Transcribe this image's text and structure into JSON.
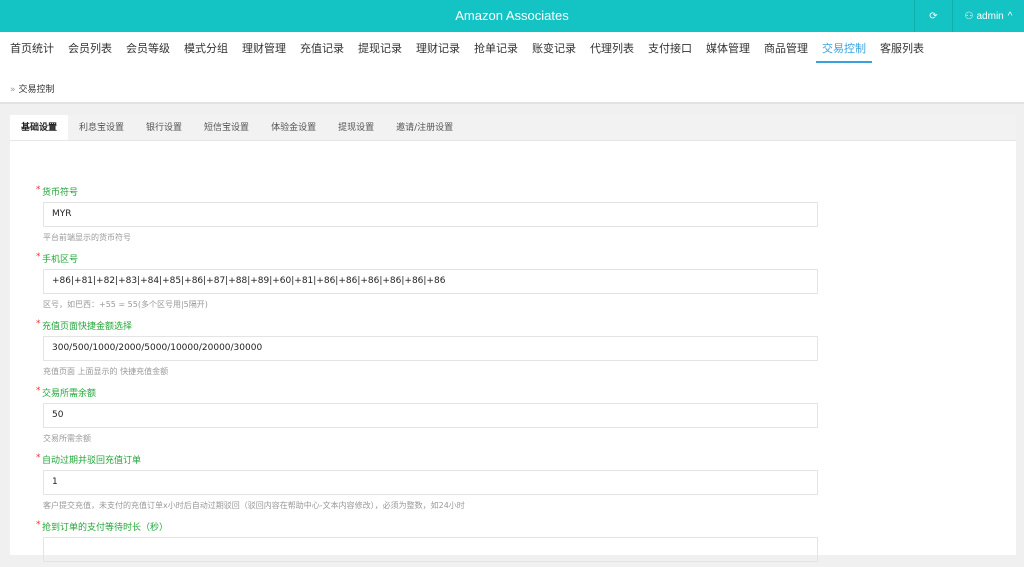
{
  "header": {
    "title": "Amazon Associates",
    "refresh_icon": "refresh-icon",
    "user": "admin"
  },
  "nav": {
    "items": [
      "首页统计",
      "会员列表",
      "会员等级",
      "模式分组",
      "理财管理",
      "充值记录",
      "提现记录",
      "理财记录",
      "抢单记录",
      "账变记录",
      "代理列表",
      "支付接口",
      "媒体管理",
      "商品管理",
      "交易控制",
      "客服列表"
    ],
    "active": 14
  },
  "breadcrumb": {
    "sep": "»",
    "current": "交易控制"
  },
  "tabs": [
    "基础设置",
    "利息宝设置",
    "银行设置",
    "短信宝设置",
    "体验金设置",
    "提现设置",
    "邀请/注册设置"
  ],
  "fields": [
    {
      "label": "货币符号",
      "value": "MYR",
      "help": "平台前端显示的货币符号"
    },
    {
      "label": "手机区号",
      "value": "+86|+81|+82|+83|+84|+85|+86|+87|+88|+89|+60|+81|+86|+86|+86|+86|+86|+86",
      "help": "区号，如巴西：+55 = 55(多个区号用|5隔开)"
    },
    {
      "label": "充值页面快捷金额选择",
      "value": "300/500/1000/2000/5000/10000/20000/30000",
      "help": "充值页面 上面显示的 快捷充值金额"
    },
    {
      "label": "交易所需余额",
      "value": "50",
      "help": "交易所需余额"
    },
    {
      "label": "自动过期并驳回充值订单",
      "value": "1",
      "help": "客户提交充值，未支付的充值订单x小时后自动过期驳回（驳回内容在帮助中心-文本内容修改），必须为整数，如24小时"
    },
    {
      "label": "抢到订单的支付等待时长（秒）",
      "value": "",
      "help": ""
    }
  ]
}
